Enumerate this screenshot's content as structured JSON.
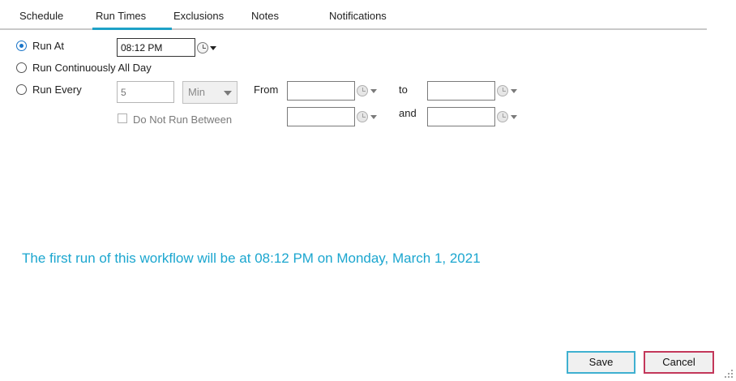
{
  "tabs": [
    {
      "label": "Schedule"
    },
    {
      "label": "Run Times",
      "active": true
    },
    {
      "label": "Exclusions"
    },
    {
      "label": "Notes"
    },
    {
      "label": "Notifications"
    }
  ],
  "run_options": {
    "run_at": {
      "label": "Run At",
      "selected": true,
      "time": "08:12 PM"
    },
    "run_continuously": {
      "label": "Run Continuously All Day",
      "selected": false
    },
    "run_every": {
      "label": "Run Every",
      "selected": false,
      "interval_placeholder": "5",
      "unit": "Min",
      "from_label": "From",
      "to_label": "to",
      "and_label": "and",
      "from_time": "",
      "to_time": "",
      "between_start": "",
      "between_end": "",
      "do_not_run_between": {
        "label": "Do Not Run Between",
        "checked": false
      }
    }
  },
  "info_text": "The first run of this workflow will be at 08:12 PM on Monday, March 1, 2021",
  "buttons": {
    "save": "Save",
    "cancel": "Cancel"
  },
  "colors": {
    "accent": "#1da1c7",
    "info_text": "#1ba6cf",
    "cancel_border": "#c3375a",
    "save_border": "#3fb0d0"
  },
  "icons": [
    "clock-icon",
    "chevron-down-icon",
    "resize-grip-icon"
  ]
}
